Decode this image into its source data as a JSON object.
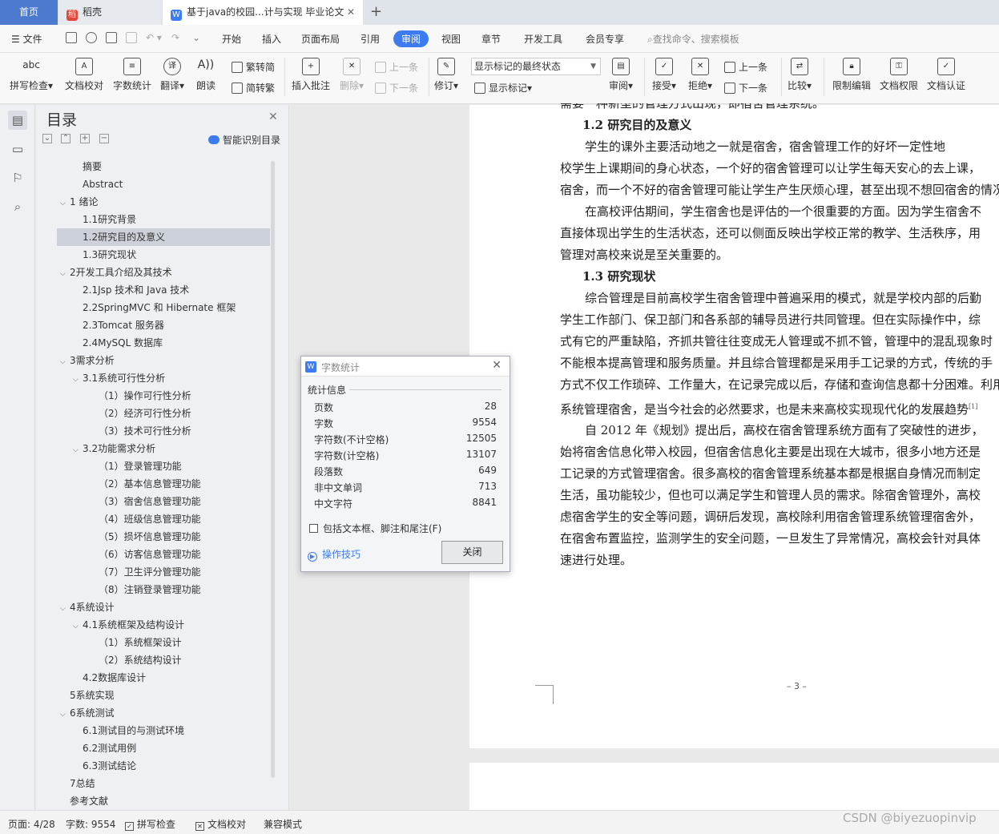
{
  "tabs": {
    "home": "首页",
    "daoke": "稻壳",
    "doc": "基于java的校园...计与实现 毕业论文"
  },
  "menu": {
    "file": "文件",
    "items": [
      "开始",
      "插入",
      "页面布局",
      "引用",
      "审阅",
      "视图",
      "章节",
      "开发工具",
      "会员专享"
    ],
    "active": "审阅",
    "search": "查找命令、搜索模板"
  },
  "toolbar": {
    "spell": "拼写检查",
    "proof": "文档校对",
    "count": "字数统计",
    "translate": "翻译",
    "read": "朗读",
    "trad": "繁转简",
    "simp": "简转繁",
    "insert_comment": "插入批注",
    "delete": "删除",
    "prev": "上一条",
    "next": "下一条",
    "revise": "修订",
    "show_select": "显示标记的最终状态",
    "show_marks": "显示标记",
    "review": "审阅",
    "accept": "接受",
    "reject": "拒绝",
    "prev2": "上一条",
    "next2": "下一条",
    "compare": "比较",
    "restrict": "限制编辑",
    "perm": "文档权限",
    "auth": "文档认证"
  },
  "toc": {
    "title": "目录",
    "smart": "智能识别目录",
    "items": [
      {
        "label": "摘要",
        "level": 1,
        "caret": ""
      },
      {
        "label": "Abstract",
        "level": 1,
        "caret": ""
      },
      {
        "label": "1 绪论",
        "level": 0,
        "caret": "v"
      },
      {
        "label": "1.1研究背景",
        "level": 1,
        "caret": ""
      },
      {
        "label": "1.2研究目的及意义",
        "level": 1,
        "caret": "",
        "selected": true
      },
      {
        "label": "1.3研究现状",
        "level": 1,
        "caret": ""
      },
      {
        "label": "2开发工具介绍及其技术",
        "level": 0,
        "caret": "v"
      },
      {
        "label": "2.1Jsp 技术和 Java 技术",
        "level": 1,
        "caret": ""
      },
      {
        "label": "2.2SpringMVC 和 Hibernate 框架",
        "level": 1,
        "caret": ""
      },
      {
        "label": "2.3Tomcat 服务器",
        "level": 1,
        "caret": ""
      },
      {
        "label": "2.4MySQL 数据库",
        "level": 1,
        "caret": ""
      },
      {
        "label": "3需求分析",
        "level": 0,
        "caret": "v"
      },
      {
        "label": "3.1系统可行性分析",
        "level": 1,
        "caret": "v"
      },
      {
        "label": "（1）操作可行性分析",
        "level": 2,
        "caret": ""
      },
      {
        "label": "（2）经济可行性分析",
        "level": 2,
        "caret": ""
      },
      {
        "label": "（3）技术可行性分析",
        "level": 2,
        "caret": ""
      },
      {
        "label": "3.2功能需求分析",
        "level": 1,
        "caret": "v"
      },
      {
        "label": "（1）登录管理功能",
        "level": 2,
        "caret": ""
      },
      {
        "label": "（2）基本信息管理功能",
        "level": 2,
        "caret": ""
      },
      {
        "label": "（3）宿舍信息管理功能",
        "level": 2,
        "caret": ""
      },
      {
        "label": "（4）班级信息管理功能",
        "level": 2,
        "caret": ""
      },
      {
        "label": "（5）损坏信息管理功能",
        "level": 2,
        "caret": ""
      },
      {
        "label": "（6）访客信息管理功能",
        "level": 2,
        "caret": ""
      },
      {
        "label": "（7）卫生评分管理功能",
        "level": 2,
        "caret": ""
      },
      {
        "label": "（8）注销登录管理功能",
        "level": 2,
        "caret": ""
      },
      {
        "label": "4系统设计",
        "level": 0,
        "caret": "v"
      },
      {
        "label": "4.1系统框架及结构设计",
        "level": 1,
        "caret": "v"
      },
      {
        "label": "（1）系统框架设计",
        "level": 2,
        "caret": ""
      },
      {
        "label": "（2）系统结构设计",
        "level": 2,
        "caret": ""
      },
      {
        "label": "4.2数据库设计",
        "level": 1,
        "caret": ""
      },
      {
        "label": "5系统实现",
        "level": 0,
        "caret": ""
      },
      {
        "label": "6系统测试",
        "level": 0,
        "caret": "v"
      },
      {
        "label": "6.1测试目的与测试环境",
        "level": 1,
        "caret": ""
      },
      {
        "label": "6.2测试用例",
        "level": 1,
        "caret": ""
      },
      {
        "label": "6.3测试结论",
        "level": 1,
        "caret": ""
      },
      {
        "label": "7总结",
        "level": 0,
        "caret": ""
      },
      {
        "label": "参考文献",
        "level": 0,
        "caret": ""
      }
    ]
  },
  "document": {
    "lines": [
      {
        "text": "需要一种新型的管理方式出现，即宿舍管理系统。",
        "indent": false,
        "heading": false
      },
      {
        "text": "1.2  研究目的及意义",
        "indent": true,
        "heading": true
      },
      {
        "text": "学生的课外主要活动地之一就是宿舍，宿舍管理工作的好坏一定性地",
        "indent": true,
        "heading": false
      },
      {
        "text": "校学生上课期间的身心状态，一个好的宿舍管理可以让学生每天安心的去上课，",
        "indent": false,
        "heading": false
      },
      {
        "text": "宿舍，而一个不好的宿舍管理可能让学生产生厌烦心理，甚至出现不想回宿舍的情况",
        "indent": false,
        "heading": false
      },
      {
        "text": "在高校评估期间，学生宿舍也是评估的一个很重要的方面。因为学生宿舍不",
        "indent": true,
        "heading": false
      },
      {
        "text": "直接体现出学生的生活状态，还可以侧面反映出学校正常的教学、生活秩序，用",
        "indent": false,
        "heading": false
      },
      {
        "text": "管理对高校来说是至关重要的。",
        "indent": false,
        "heading": false
      },
      {
        "text": "1.3  研究现状",
        "indent": true,
        "heading": true
      },
      {
        "text": "综合管理是目前高校学生宿舍管理中普遍采用的模式，就是学校内部的后勤",
        "indent": true,
        "heading": false
      },
      {
        "text": "学生工作部门、保卫部门和各系部的辅导员进行共同管理。但在实际操作中，综",
        "indent": false,
        "heading": false
      },
      {
        "text": "式有它的严重缺陷，齐抓共管往往变成无人管理或不抓不管，管理中的混乱现象时",
        "indent": false,
        "heading": false
      },
      {
        "text": "不能根本提高管理和服务质量。并且综合管理都是采用手工记录的方式，传统的手",
        "indent": false,
        "heading": false
      },
      {
        "text": "方式不仅工作琐碎、工作量大，在记录完成以后，存储和查询信息都十分困难。利用",
        "indent": false,
        "heading": false
      },
      {
        "text": "系统管理宿舍，是当今社会的必然要求，也是未来高校实现现代化的发展趋势",
        "indent": false,
        "heading": false,
        "cite": "[1]"
      },
      {
        "text": "自 2012 年《规划》提出后，高校在宿舍管理系统方面有了突破性的进步，",
        "indent": true,
        "heading": false
      },
      {
        "text": "始将宿舍信息化带入校园，但宿舍信息化主要是出现在大城市，很多小地方还是",
        "indent": false,
        "heading": false
      },
      {
        "text": "工记录的方式管理宿舍。很多高校的宿舍管理系统基本都是根据自身情况而制定",
        "indent": false,
        "heading": false
      },
      {
        "text": "生活，虽功能较少，但也可以满足学生和管理人员的需求。除宿舍管理外，高校",
        "indent": false,
        "heading": false
      },
      {
        "text": "虑宿舍学生的安全等问题，调研后发现，高校除利用宿舍管理系统管理宿舍外，",
        "indent": false,
        "heading": false
      },
      {
        "text": "在宿舍布置监控，监测学生的安全问题，一旦发生了异常情况，高校会针对具体",
        "indent": false,
        "heading": false
      },
      {
        "text": "速进行处理。",
        "indent": false,
        "heading": false
      }
    ],
    "page_number": "– 3 –"
  },
  "dialog": {
    "title": "字数统计",
    "group": "统计信息",
    "stats": [
      {
        "label": "页数",
        "value": "28"
      },
      {
        "label": "字数",
        "value": "9554"
      },
      {
        "label": "字符数(不计空格)",
        "value": "12505"
      },
      {
        "label": "字符数(计空格)",
        "value": "13107"
      },
      {
        "label": "段落数",
        "value": "649"
      },
      {
        "label": "非中文单词",
        "value": "713"
      },
      {
        "label": "中文字符",
        "value": "8841"
      }
    ],
    "checkbox": "包括文本框、脚注和尾注(F)",
    "tips": "操作技巧",
    "close": "关闭"
  },
  "status": {
    "page": "页面: 4/28",
    "words": "字数: 9554",
    "spell": "拼写检查",
    "proof": "文档校对",
    "compat": "兼容模式"
  },
  "watermark": "CSDN @biyezuopinvip"
}
